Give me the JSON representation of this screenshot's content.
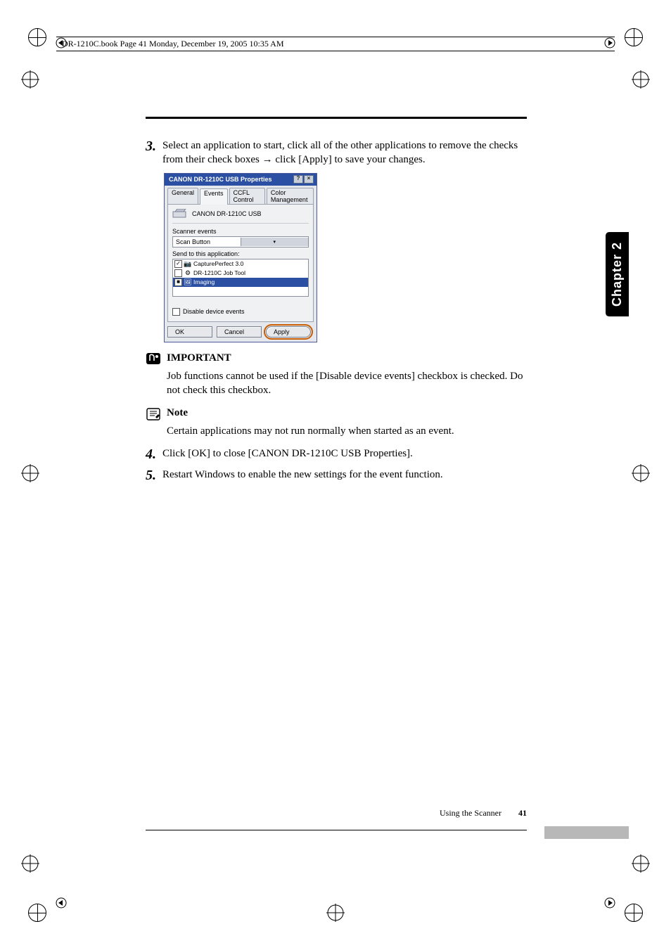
{
  "running_head": "DR-1210C.book  Page 41  Monday, December 19, 2005  10:35 AM",
  "chapter_tab": "Chapter 2",
  "step3": {
    "num": "3.",
    "text": "Select an application to start, click all of the other applications to remove the checks from their check boxes → click [Apply] to save your changes."
  },
  "dialog": {
    "title": "CANON DR-1210C USB Properties",
    "help_btn": "?",
    "close_btn": "×",
    "tabs": {
      "general": "General",
      "events": "Events",
      "ccfl": "CCFL Control",
      "color": "Color Management"
    },
    "device_name": "CANON DR-1210C USB",
    "scanner_events_label": "Scanner events",
    "scanner_events_value": "Scan Button",
    "send_to_label": "Send to this application:",
    "apps": [
      {
        "checked": true,
        "icon": "📷",
        "label": "CapturePerfect 3.0",
        "selected": false
      },
      {
        "checked": false,
        "icon": "⚙",
        "label": "DR-1210C Job Tool",
        "selected": false
      },
      {
        "checked": true,
        "icon": "🖼",
        "label": "Imaging",
        "selected": true
      }
    ],
    "disable_label": "Disable device events",
    "ok": "OK",
    "cancel": "Cancel",
    "apply": "Apply"
  },
  "important": {
    "title": "IMPORTANT",
    "body": "Job functions cannot be used if the [Disable device events] checkbox is checked. Do not check this checkbox."
  },
  "note": {
    "title": "Note",
    "body": "Certain applications may not run normally when started as an event."
  },
  "step4": {
    "num": "4.",
    "text": "Click [OK] to close [CANON DR-1210C USB Properties]."
  },
  "step5": {
    "num": "5.",
    "text": "Restart Windows to enable the new settings for the event function."
  },
  "footer": {
    "section": "Using the Scanner",
    "page": "41"
  }
}
